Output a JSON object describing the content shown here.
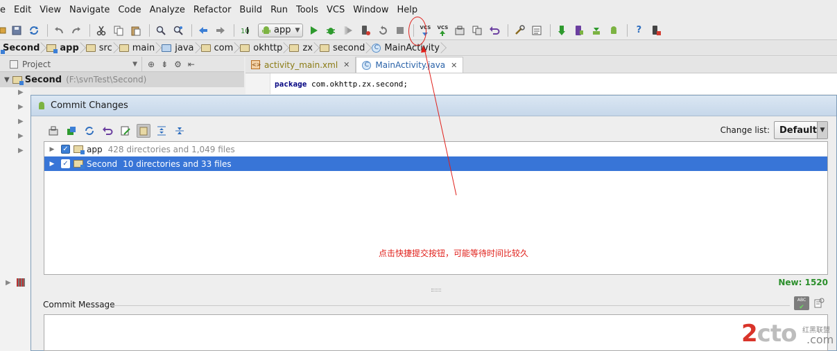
{
  "menu": [
    "e",
    "Edit",
    "View",
    "Navigate",
    "Code",
    "Analyze",
    "Refactor",
    "Build",
    "Run",
    "Tools",
    "VCS",
    "Window",
    "Help"
  ],
  "toolbar": {
    "run_config": "app",
    "vcs_update_label": "VCS",
    "vcs_commit_label": "VCS",
    "help_label": "?"
  },
  "breadcrumb": [
    "Second",
    "app",
    "src",
    "main",
    "java",
    "com",
    "okhttp",
    "zx",
    "second",
    "MainActivity"
  ],
  "project_panel": {
    "tab_label": "Project",
    "root_name": "Second",
    "root_path": "(F:\\svnTest\\Second)"
  },
  "editor": {
    "tabs": [
      {
        "label": "activity_main.xml",
        "icon": "xml-file-icon",
        "active": false
      },
      {
        "label": "MainActivity.java",
        "icon": "class-c-icon",
        "active": true
      }
    ],
    "code_keyword": "package",
    "code_rest": " com.okhttp.zx.second;"
  },
  "dialog": {
    "title": "Commit Changes",
    "change_list_label": "Change list:",
    "change_list_value": "Default",
    "rows": [
      {
        "name": "app",
        "info": "428 directories and 1,049 files",
        "checked": true,
        "selected": false
      },
      {
        "name": "Second",
        "info": "10 directories and 33 files",
        "checked": true,
        "selected": true
      }
    ],
    "new_count": "New: 1520",
    "commit_message_label": "Commit Message",
    "spellcheck_label": "ABC"
  },
  "annotation": "点击快捷提交按钮，可能等待时间比较久",
  "watermark": {
    "main": "2cto",
    "sub": "红黑联盟",
    "domain": ".com"
  },
  "colors": {
    "selection": "#3875d7",
    "annotation_red": "#e0201b",
    "new_count_green": "#2c8f2c"
  }
}
